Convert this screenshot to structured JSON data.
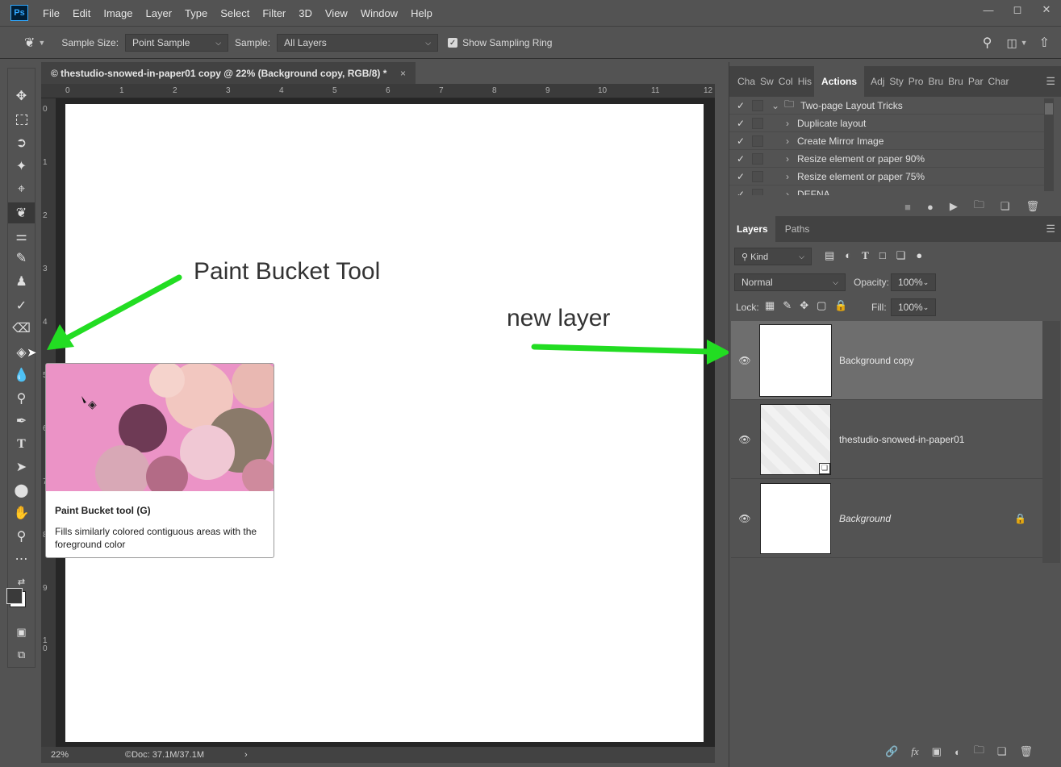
{
  "app": {
    "logo": "Ps",
    "menus": [
      "File",
      "Edit",
      "Image",
      "Layer",
      "Type",
      "Select",
      "Filter",
      "3D",
      "View",
      "Window",
      "Help"
    ],
    "window_controls": [
      "minimize-icon",
      "maximize-icon",
      "close-icon"
    ]
  },
  "options": {
    "sample_size_label": "Sample Size:",
    "sample_size_value": "Point Sample",
    "sample_label": "Sample:",
    "sample_value": "All Layers",
    "show_ring_label": "Show Sampling Ring",
    "show_ring_checked": true
  },
  "document": {
    "tab_title": "© thestudio-snowed-in-paper01 copy @ 22% (Background copy, RGB/8) *",
    "close": "×",
    "zoom": "22%",
    "doc_info": "©Doc: 37.1M/37.1M",
    "hruler": [
      "0",
      "1",
      "2",
      "3",
      "4",
      "5",
      "6",
      "7",
      "8",
      "9",
      "10",
      "11",
      "12"
    ],
    "vruler": [
      "0",
      "1",
      "2",
      "3",
      "4",
      "5",
      "6",
      "7",
      "8",
      "9",
      "1\n0"
    ]
  },
  "annotations": {
    "paint_bucket": "Paint Bucket Tool",
    "new_layer": "new layer",
    "arrow_color": "#22dd22"
  },
  "tooltip": {
    "title": "Paint Bucket tool (G)",
    "description": "Fills similarly colored contiguous areas with the foreground color"
  },
  "actions_panel": {
    "tabs": [
      "Cha",
      "Sw",
      "Col",
      "His",
      "Actions",
      "Adj",
      "Sty",
      "Pro",
      "Bru",
      "Bru",
      "Par",
      "Char"
    ],
    "active_tab": "Actions",
    "rows": [
      {
        "label": "Two-page Layout Tricks",
        "type": "set"
      },
      {
        "label": "Duplicate layout",
        "type": "action"
      },
      {
        "label": "Create Mirror Image",
        "type": "action"
      },
      {
        "label": "Resize element or paper 90%",
        "type": "action"
      },
      {
        "label": "Resize element or paper 75%",
        "type": "action"
      },
      {
        "label": "DEFNA",
        "type": "action"
      }
    ]
  },
  "layers_panel": {
    "tabs": [
      "Layers",
      "Paths"
    ],
    "kind_label": "Kind",
    "blend_mode": "Normal",
    "opacity_label": "Opacity:",
    "opacity_value": "100%",
    "lock_label": "Lock:",
    "fill_label": "Fill:",
    "fill_value": "100%",
    "layers": [
      {
        "name": "Background copy",
        "selected": true
      },
      {
        "name": "thestudio-snowed-in-paper01",
        "selected": false
      },
      {
        "name": "Background",
        "selected": false,
        "locked": true
      }
    ]
  }
}
